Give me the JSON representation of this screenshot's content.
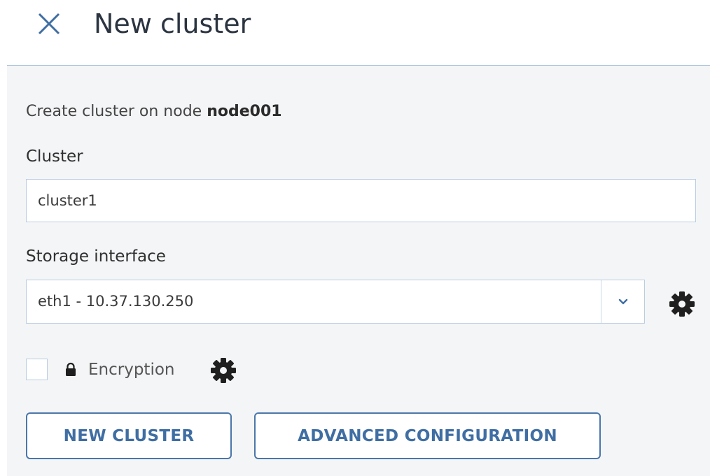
{
  "header": {
    "title": "New cluster",
    "close_icon": "close-icon"
  },
  "intro": {
    "prefix": "Create cluster on node ",
    "node": "node001"
  },
  "cluster": {
    "label": "Cluster",
    "value": "cluster1"
  },
  "storage": {
    "label": "Storage interface",
    "selected": "eth1 - 10.37.130.250",
    "arrow_icon": "chevron-down-icon",
    "settings_icon": "gear-icon"
  },
  "encryption": {
    "label": "Encryption",
    "checked": false,
    "lock_icon": "lock-icon",
    "settings_icon": "gear-icon"
  },
  "buttons": {
    "new_cluster": "NEW CLUSTER",
    "advanced": "ADVANCED CONFIGURATION"
  },
  "colors": {
    "accent": "#3f6ea3",
    "border": "#b9cde2",
    "panel_bg": "#f4f5f6",
    "icon_dark": "#1f1f1f"
  }
}
